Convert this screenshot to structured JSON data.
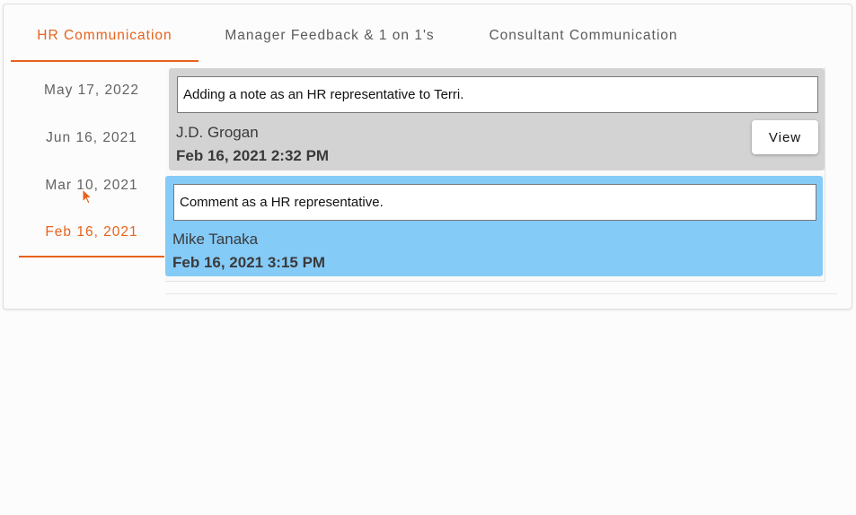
{
  "tabs": [
    {
      "label": "HR Communication",
      "active": true
    },
    {
      "label": "Manager Feedback & 1 on 1's",
      "active": false
    },
    {
      "label": "Consultant Communication",
      "active": false
    }
  ],
  "dates": [
    {
      "label": "May 17, 2022",
      "active": false
    },
    {
      "label": "Jun 16, 2021",
      "active": false
    },
    {
      "label": "Mar 10, 2021",
      "active": false
    },
    {
      "label": "Feb 16, 2021",
      "active": true
    }
  ],
  "notes": [
    {
      "text": "Adding a note as an HR representative to Terri.",
      "author": "J.D. Grogan",
      "timestamp": "Feb 16, 2021 2:32 PM",
      "view_label": "View",
      "color": "#d3d3d3"
    },
    {
      "text": "Comment as a HR representative.",
      "author": "Mike Tanaka",
      "timestamp": "Feb 16, 2021 3:15 PM",
      "color": "#85cbf8"
    }
  ],
  "colors": {
    "accent": "#e8621c"
  },
  "cursor": {
    "icon": "mouse-pointer-icon"
  }
}
